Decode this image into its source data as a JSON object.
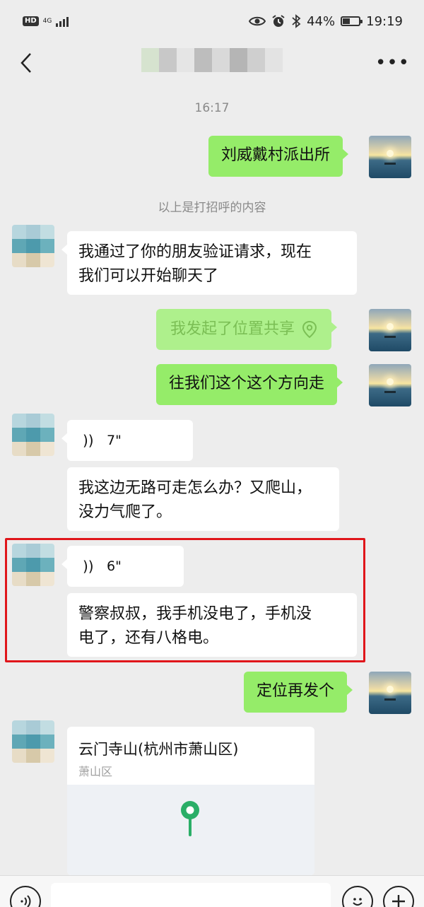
{
  "status_bar": {
    "hd": "HD",
    "network": "4G",
    "battery_percent": "44%",
    "battery_level": 0.44,
    "time": "19:19",
    "icons": [
      "eye-icon",
      "alarm-icon",
      "bluetooth-icon"
    ]
  },
  "header": {
    "back_icon": "chevron-left-icon",
    "more_label": "•••"
  },
  "chat": {
    "timestamp": "16:17",
    "system_message": "以上是打招呼的内容",
    "messages": [
      {
        "side": "out",
        "type": "text",
        "text": "刘威戴村派出所"
      },
      {
        "side": "in",
        "type": "text",
        "line1": "我通过了你的朋友验证请求，现在",
        "line2": "我们可以开始聊天了"
      },
      {
        "side": "out",
        "type": "location-share",
        "text": "我发起了位置共享",
        "icon": "location-pin-icon"
      },
      {
        "side": "out",
        "type": "text",
        "text": "往我们这个这个方向走"
      },
      {
        "side": "in",
        "type": "voice",
        "duration": "7\""
      },
      {
        "side": "in",
        "type": "text",
        "line1": "我这边无路可走怎么办？又爬山，",
        "line2": "没力气爬了。"
      },
      {
        "side": "in",
        "type": "voice",
        "duration": "6\""
      },
      {
        "side": "in",
        "type": "text",
        "line1": "警察叔叔，我手机没电了，手机没",
        "line2": "电了，还有八格电。"
      },
      {
        "side": "out",
        "type": "text",
        "text": "定位再发个"
      },
      {
        "side": "in",
        "type": "location",
        "title": "云门寺山(杭州市萧山区)",
        "subtitle": "萧山区"
      }
    ]
  },
  "input_bar": {
    "voice_icon": "voice-icon",
    "emoji_icon": "emoji-icon",
    "plus_icon": "plus-icon"
  },
  "colors": {
    "background": "#ededed",
    "outgoing_bubble": "#95ec69",
    "incoming_bubble": "#ffffff",
    "highlight": "#e0161b",
    "map_pin": "#2aae67"
  }
}
